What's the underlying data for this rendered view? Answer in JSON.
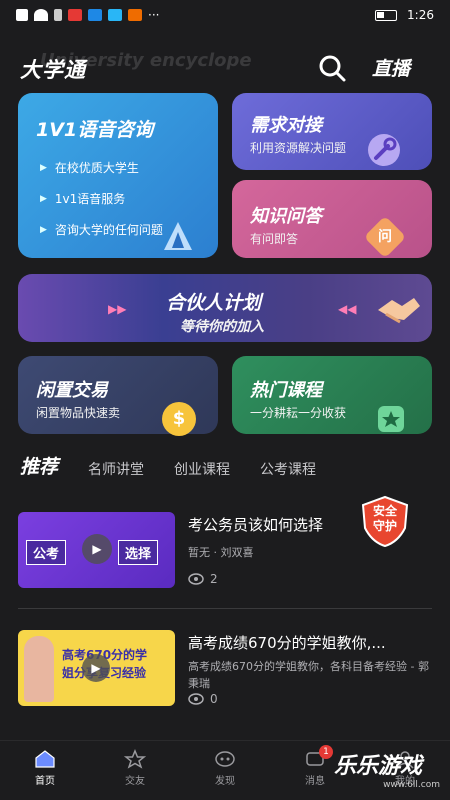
{
  "status_bar": {
    "time": "1:26"
  },
  "header": {
    "title": "大学通",
    "watermark": "University encyclope",
    "live_label": "直播"
  },
  "cards": {
    "voice": {
      "title": "1V1语音咨询",
      "items": [
        "在校优质大学生",
        "1v1语音服务",
        "咨询大学的任何问题"
      ]
    },
    "demand": {
      "title": "需求对接",
      "subtitle": "利用资源解决问题"
    },
    "qa": {
      "title": "知识问答",
      "subtitle": "有问即答",
      "badge": "问"
    },
    "partner": {
      "title": "合伙人计划",
      "subtitle": "等待你的加入"
    },
    "idle": {
      "title": "闲置交易",
      "subtitle": "闲置物品快速卖",
      "badge": "$"
    },
    "hot": {
      "title": "热门课程",
      "subtitle": "一分耕耘一分收获"
    }
  },
  "tabs": [
    "推荐",
    "名师讲堂",
    "创业课程",
    "公考课程"
  ],
  "badge_safe": {
    "line1": "安全",
    "line2": "守护"
  },
  "list": [
    {
      "title": "考公务员该如何选择",
      "desc": "暂无 · 刘双喜",
      "views": "2",
      "thumb_left": "公考",
      "thumb_right": "选择"
    },
    {
      "title": "高考成绩670分的学姐教你,...",
      "desc": "高考成绩670分的学姐教你，各科目备考经验 - 郭秉瑞",
      "views": "0",
      "thumb_line1": "高考670分的学",
      "thumb_line2": "姐分享复习经验"
    }
  ],
  "nav": {
    "items": [
      "首页",
      "交友",
      "发现",
      "消息",
      "我的"
    ],
    "message_badge": "1"
  },
  "corner_watermark": {
    "big": "乐乐游戏",
    "small": "www.6ll.com"
  },
  "colors": {
    "background": "#1c1c1e",
    "voice_card": "#3da9e6",
    "demand_card": "#6e6cd9",
    "qa_card": "#d4679b",
    "idle_card": "#3e4a73",
    "hot_card": "#2f8f5e"
  }
}
